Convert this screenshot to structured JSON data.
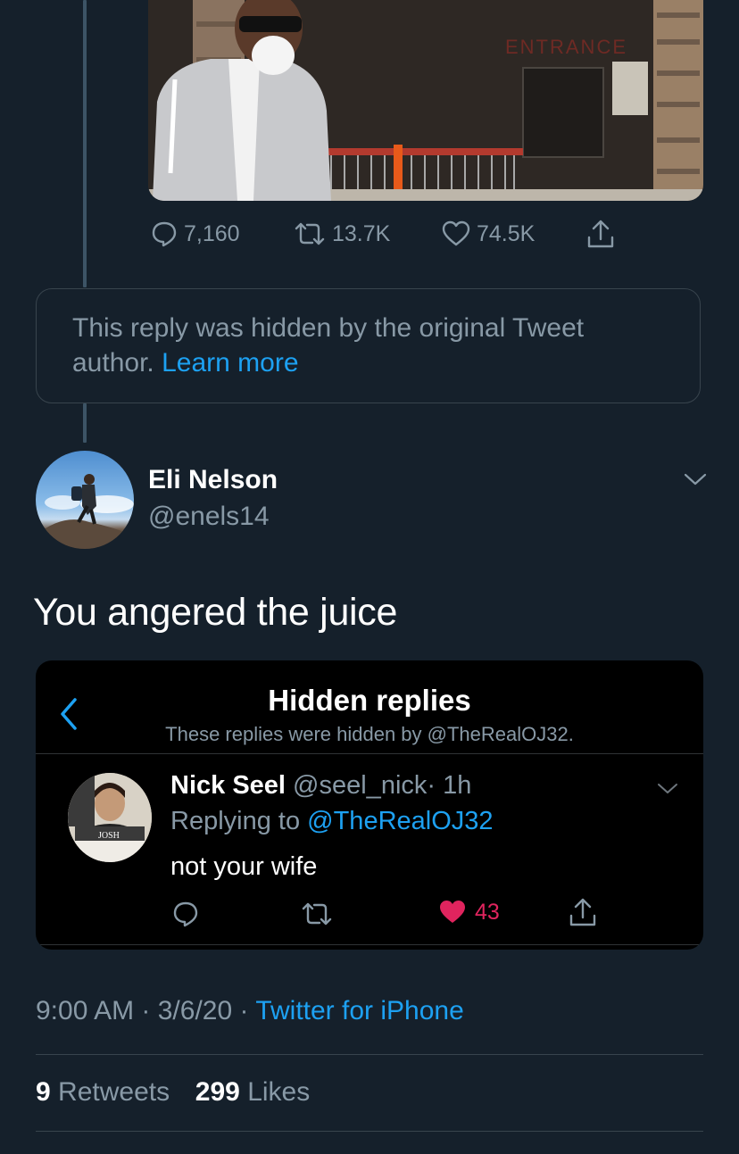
{
  "tweet_actions": {
    "replies": "7,160",
    "retweets": "13.7K",
    "likes": "74.5K"
  },
  "photo": {
    "sign_text": "ENTRANCE"
  },
  "hidden_notice": {
    "text": "This reply was hidden by the original Tweet author.",
    "link": "Learn more"
  },
  "reply": {
    "display_name": "Eli Nelson",
    "handle": "@enels14",
    "text": "You angered the juice"
  },
  "embedded": {
    "title": "Hidden replies",
    "subtitle": "These replies were hidden by @TheRealOJ32.",
    "reply": {
      "name": "Nick Seel",
      "handle": "@seel_nick",
      "time": "· 1h",
      "replying_prefix": "Replying to",
      "replying_to": "@TheRealOJ32",
      "text": "not your wife",
      "likes": "43"
    },
    "avatar_shirt_text": "JOSH"
  },
  "footer": {
    "time": "9:00 AM",
    "date": "3/6/20",
    "source": "Twitter for iPhone",
    "retweet_count": "9",
    "retweet_label": "Retweets",
    "like_count": "299",
    "like_label": "Likes"
  },
  "colors": {
    "background": "#15202b",
    "accent": "#1da1f2",
    "muted": "#8899a6",
    "like_red": "#e0245e"
  }
}
